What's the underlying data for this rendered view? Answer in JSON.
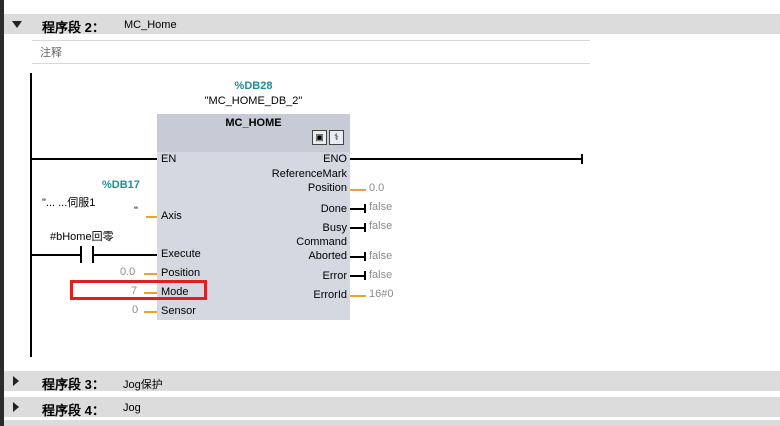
{
  "network2": {
    "title": "程序段 2：",
    "name": "MC_Home",
    "comment": "注释"
  },
  "block": {
    "db_number": "%DB28",
    "instance": "\"MC_HOME_DB_2\"",
    "type": "MC_HOME",
    "inputs": {
      "en": "EN",
      "axis": "Axis",
      "execute": "Execute",
      "position": "Position",
      "mode": "Mode",
      "sensor": "Sensor"
    },
    "outputs": {
      "eno": "ENO",
      "refmark_l1": "ReferenceMark",
      "refmark_l2": "Position",
      "done": "Done",
      "busy": "Busy",
      "cmd_l1": "Command",
      "cmd_l2": "Aborted",
      "error": "Error",
      "errorid": "ErrorId"
    }
  },
  "axis_operand": {
    "db": "%DB17",
    "name": "\"...    ...伺服1",
    "quote": "\""
  },
  "execute_operand": "#bHome回零",
  "input_values": {
    "position": "0.0",
    "mode": "7",
    "sensor": "0"
  },
  "output_values": {
    "refmark_position": "0.0",
    "done": "false",
    "busy": "false",
    "cmd_aborted": "false",
    "error": "false",
    "errorid": "16#0"
  },
  "network3": {
    "title": "程序段 3：",
    "name": "Jog保护"
  },
  "network4": {
    "title": "程序段 4：",
    "name": "Jog"
  },
  "colors": {
    "highlight": "#e02020",
    "db": "#1e9090",
    "wire_value": "#f0a030"
  }
}
